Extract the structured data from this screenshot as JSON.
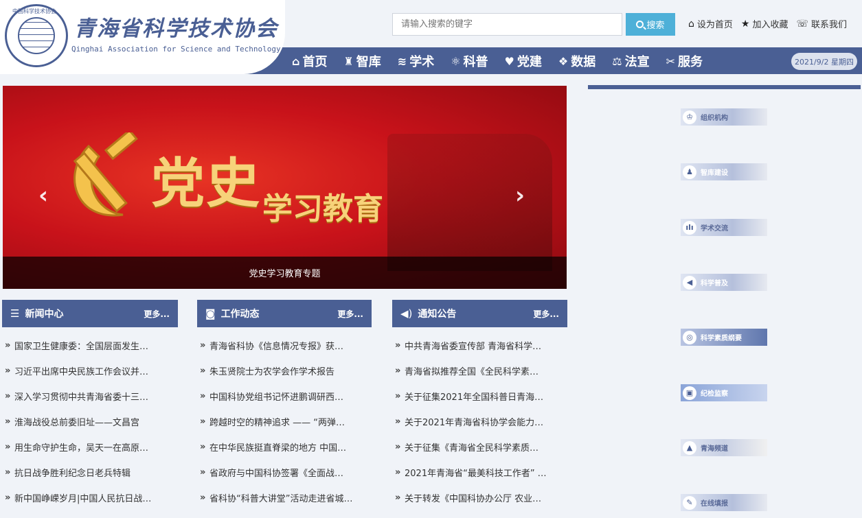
{
  "header": {
    "title_cn": "青海省科学技术协会",
    "title_en": "Qinghai Association for Science and Technology",
    "emblem_ring_text": "中国科学技术协会",
    "search_placeholder": "请输入搜索的键字",
    "search_button": "搜索",
    "top_links": [
      {
        "icon": "home-icon",
        "glyph": "⌂",
        "label": "设为首页"
      },
      {
        "icon": "star-icon",
        "glyph": "★",
        "label": "加入收藏"
      },
      {
        "icon": "phone-icon",
        "glyph": "☏",
        "label": "联系我们"
      }
    ],
    "date": "2021/9/2 星期四"
  },
  "nav": {
    "items": [
      {
        "icon": "home-icon",
        "glyph": "⌂",
        "label": "首页"
      },
      {
        "icon": "think-tank-icon",
        "glyph": "♜",
        "label": "智库"
      },
      {
        "icon": "academic-icon",
        "glyph": "≋",
        "label": "学术"
      },
      {
        "icon": "atom-icon",
        "glyph": "⚛",
        "label": "科普"
      },
      {
        "icon": "heart-icon",
        "glyph": "♥",
        "label": "党建"
      },
      {
        "icon": "data-icon",
        "glyph": "❖",
        "label": "数据"
      },
      {
        "icon": "law-icon",
        "glyph": "⚖",
        "label": "法宣"
      },
      {
        "icon": "tools-icon",
        "glyph": "✂",
        "label": "服务"
      }
    ]
  },
  "banner": {
    "title": "党史",
    "subtitle": "学习教育",
    "caption": "党史学习教育专题",
    "prev": "‹",
    "next": "›"
  },
  "columns": [
    {
      "icon": "list-icon",
      "glyph": "☰",
      "title": "新闻中心",
      "more": "更多...",
      "items": [
        {
          "bullet": "»",
          "text": "国家卫生健康委：全国层面发生…"
        },
        {
          "bullet": "»",
          "text": "习近平出席中央民族工作会议并…"
        },
        {
          "bullet": "»",
          "text": "深入学习贯彻中共青海省委十三…"
        },
        {
          "bullet": "»",
          "text": "淮海战役总前委旧址——文昌宫"
        },
        {
          "bullet": "»",
          "text": "用生命守护生命，吴天一在高原…"
        },
        {
          "bullet": "»",
          "text": "抗日战争胜利纪念日老兵特辑"
        },
        {
          "bullet": "»",
          "text": "新中国峥嵘岁月|中国人民抗日战…"
        }
      ]
    },
    {
      "icon": "rss-icon",
      "glyph": "◙",
      "title": "工作动态",
      "more": "更多...",
      "items": [
        {
          "bullet": "»",
          "text": "青海省科协《信息情况专报》获…"
        },
        {
          "bullet": "»",
          "text": "朱玉贤院士为农学会作学术报告"
        },
        {
          "bullet": "»",
          "text": "中国科协党组书记怀进鹏调研西…"
        },
        {
          "bullet": "»",
          "text": "跨越时空的精神追求 —— “两弹…"
        },
        {
          "bullet": "»",
          "text": "在中华民族挺直脊梁的地方 中国…"
        },
        {
          "bullet": "»",
          "text": "省政府与中国科协签署《全面战…"
        },
        {
          "bullet": "»",
          "text": "省科协“科普大讲堂”活动走进省城…"
        }
      ]
    },
    {
      "icon": "speaker-icon",
      "glyph": "◀)",
      "title": "通知公告",
      "more": "更多...",
      "items": [
        {
          "bullet": "»",
          "text": "中共青海省委宣传部 青海省科学…"
        },
        {
          "bullet": "»",
          "text": "青海省拟推荐全国《全民科学素…"
        },
        {
          "bullet": "»",
          "text": "关于征集2021年全国科普日青海…"
        },
        {
          "bullet": "»",
          "text": "关于2021年青海省科协学会能力…"
        },
        {
          "bullet": "»",
          "text": "关于征集《青海省全民科学素质…"
        },
        {
          "bullet": "»",
          "text": "2021年青海省“最美科技工作者” …"
        },
        {
          "bullet": "»",
          "text": "关于转发《中国科协办公厅 农业…"
        }
      ]
    }
  ],
  "sidebar": {
    "tiles": [
      {
        "icon": "org-icon",
        "glyph": "♔",
        "label": "组织机构"
      },
      {
        "icon": "person-icon",
        "glyph": "♟",
        "label": "智库建设"
      },
      {
        "icon": "chart-icon",
        "glyph": "ılı",
        "label": "学术交流"
      },
      {
        "icon": "megaphone-icon",
        "glyph": "◀",
        "label": "科学普及"
      },
      {
        "icon": "target-icon",
        "glyph": "◎",
        "label": "科学素质纲要"
      },
      {
        "icon": "book-icon",
        "glyph": "▣",
        "label": "纪检监察"
      },
      {
        "icon": "mountain-icon",
        "glyph": "▲",
        "label": "青海频道"
      },
      {
        "icon": "form-icon",
        "glyph": "✎",
        "label": "在线填报"
      }
    ]
  },
  "colors": {
    "brand": "#4a5f94",
    "search_button": "#4eb0d8",
    "banner_red": "#c8121a",
    "banner_gold": "#f7d27a"
  }
}
